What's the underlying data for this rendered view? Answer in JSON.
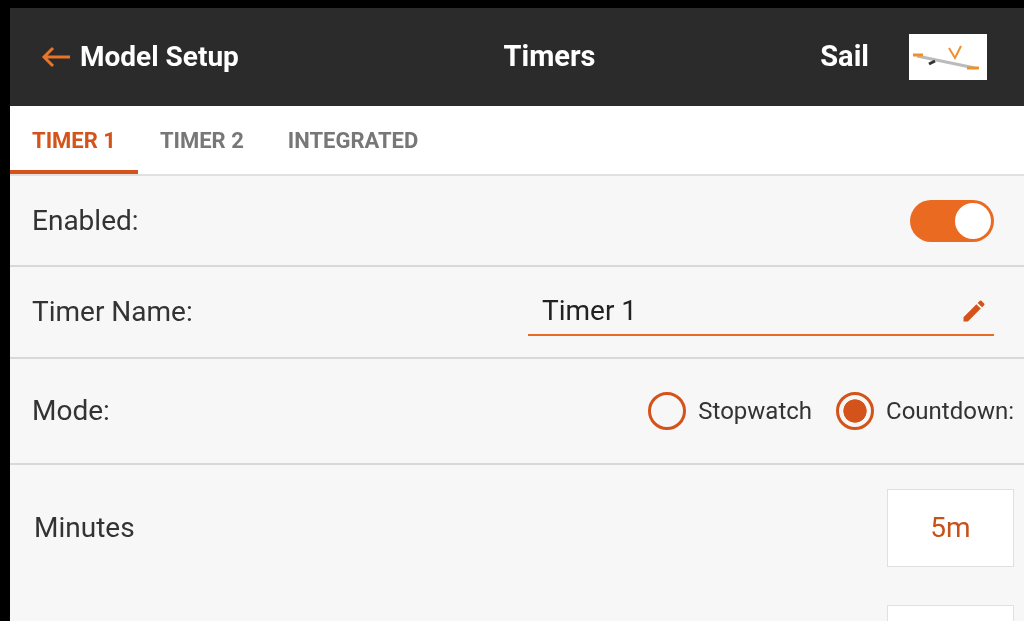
{
  "header": {
    "back_label": "Model Setup",
    "title": "Timers",
    "model_name": "Sail"
  },
  "tabs": [
    {
      "label": "TIMER 1",
      "selected": true
    },
    {
      "label": "TIMER 2",
      "selected": false
    },
    {
      "label": "INTEGRATED",
      "selected": false
    }
  ],
  "enabled": {
    "label": "Enabled:",
    "on": true
  },
  "timer_name": {
    "label": "Timer Name:",
    "value": "Timer 1"
  },
  "mode": {
    "label": "Mode:",
    "options": [
      {
        "label": "Stopwatch",
        "selected": false
      },
      {
        "label": "Countdown:",
        "selected": true
      }
    ]
  },
  "minutes": {
    "label": "Minutes",
    "value": "5m"
  }
}
